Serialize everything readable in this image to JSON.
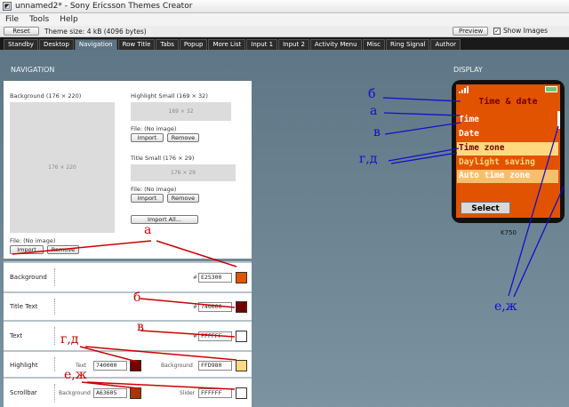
{
  "window": {
    "title": "unnamed2* - Sony Ericsson Themes Creator"
  },
  "menu": [
    "File",
    "Tools",
    "Help"
  ],
  "toolbar": {
    "reset": "Reset",
    "theme_size": "Theme size: 4 kB (4096 bytes)",
    "preview": "Preview",
    "show_images": "Show Images",
    "show_images_checked": true
  },
  "tabs": [
    "Standby",
    "Desktop",
    "Navigation",
    "Row Title",
    "Tabs",
    "Popup",
    "More List",
    "Input 1",
    "Input 2",
    "Activity Menu",
    "Misc",
    "Ring Signal",
    "Author"
  ],
  "active_tab": "Navigation",
  "navigation": {
    "title": "NAVIGATION",
    "background_label": "Background (176 × 220)",
    "background_ph": "176 × 220",
    "highlight_label": "Highlight Small (169 × 32)",
    "highlight_ph": "169 × 32",
    "title_small_label": "Title Small (176 × 29)",
    "title_small_ph": "176 × 29",
    "file_no_image": "File: (No image)",
    "import": "Import",
    "remove": "Remove",
    "import_all": "Import All..."
  },
  "colors": {
    "background": {
      "label": "Background",
      "hex": "E25300",
      "swatch": "#E25300"
    },
    "title_text": {
      "label": "Title Text",
      "hex": "740000",
      "swatch": "#740000"
    },
    "text": {
      "label": "Text",
      "hex": "FFFFFF",
      "swatch": "#FFFFFF"
    },
    "highlight": {
      "label": "Highlight",
      "text_label": "Text",
      "text_hex": "740000",
      "text_swatch": "#740000",
      "bg_label": "Background",
      "bg_hex": "FFD980",
      "bg_swatch": "#FFD980"
    },
    "scrollbar": {
      "label": "Scrollbar",
      "bg_label": "Background",
      "bg_hex": "A63605",
      "bg_swatch": "#A63605",
      "slider_label": "Slider",
      "slider_hex": "FFFFFF",
      "slider_swatch": "#FFFFFF"
    }
  },
  "display": {
    "title": "DISPLAY",
    "phone_title": "Time & date",
    "items": [
      "Time",
      "Date",
      "Time zone",
      "Daylight saving",
      "Auto time zone"
    ],
    "select": "Select",
    "model": "K750"
  },
  "annotations": {
    "a": "а",
    "b": "б",
    "v": "в",
    "gd": "г,д",
    "ezh": "е,ж"
  }
}
